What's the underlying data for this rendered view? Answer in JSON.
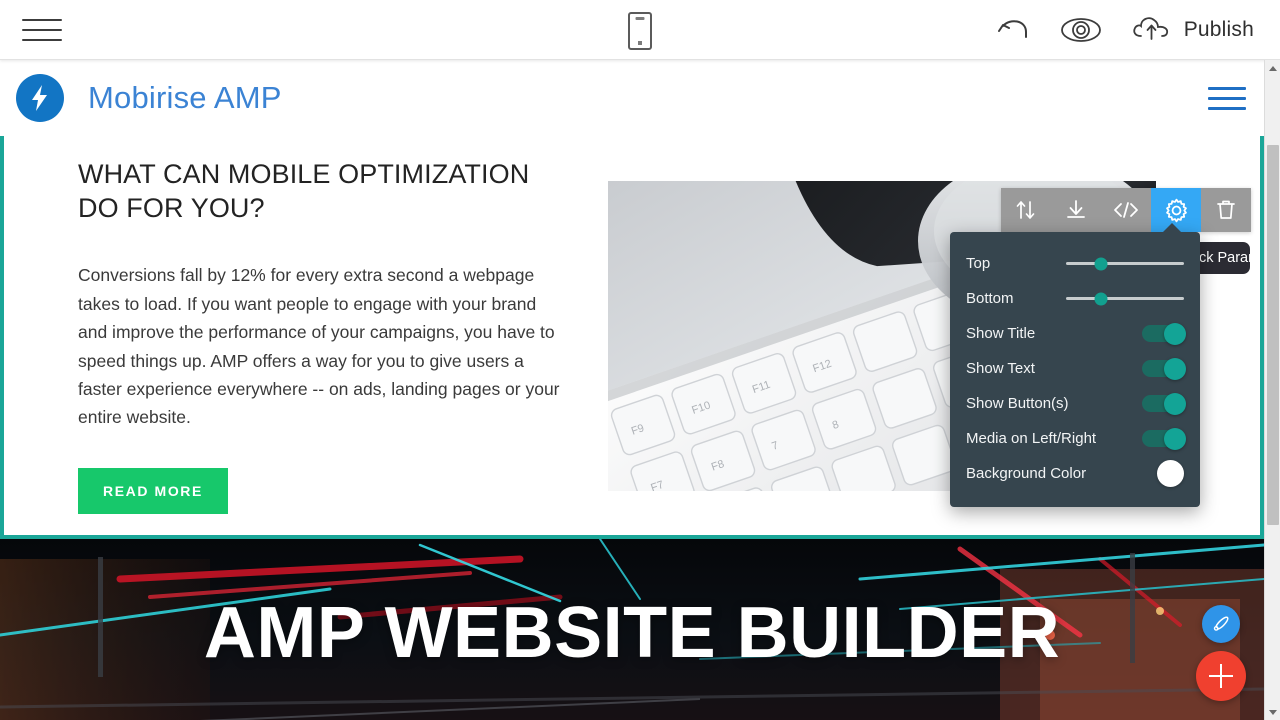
{
  "appbar": {
    "menu_icon": "hamburger-menu-icon",
    "device_icon": "mobile-device-preview-icon",
    "undo_icon": "undo-arrow-icon",
    "preview_icon": "eye-preview-icon",
    "publish_icon": "cloud-upload-icon",
    "publish_label": "Publish"
  },
  "site_nav": {
    "logo_icon": "lightning-bolt-logo-icon",
    "brand": "Mobirise AMP",
    "menu_icon": "site-hamburger-menu-icon",
    "brand_color": "#3b83d4",
    "logo_bg": "#1275c4"
  },
  "block": {
    "title": "WHAT CAN MOBILE OPTIMIZATION DO FOR YOU?",
    "body": "Conversions fall by 12% for every extra second a webpage takes to load. If you want people to engage with your brand and improve the performance of your campaigns, you have to speed things up. AMP offers a way for you to give users a faster experience everywhere -- on ads, landing pages or your entire website.",
    "button_label": "READ MORE",
    "button_color": "#17c86b",
    "selection_color": "#1aa698",
    "media_alt": "keyboard-and-phone-photo"
  },
  "hero": {
    "title": "AMP WEBSITE BUILDER"
  },
  "block_toolbar": {
    "items": [
      {
        "name": "move-block-icon",
        "label": "move"
      },
      {
        "name": "download-block-icon",
        "label": "download"
      },
      {
        "name": "edit-code-icon",
        "label": "</>"
      },
      {
        "name": "block-parameters-gear-icon",
        "label": "settings"
      },
      {
        "name": "delete-block-icon",
        "label": "delete"
      }
    ],
    "active_index": 3,
    "active_color": "#34a8f5",
    "bar_color": "#9a9a9a"
  },
  "tooltip": {
    "text": "Block Parameters"
  },
  "settings_panel": {
    "rows": [
      {
        "label": "Top",
        "type": "slider",
        "value": 30
      },
      {
        "label": "Bottom",
        "type": "slider",
        "value": 30
      },
      {
        "label": "Show Title",
        "type": "toggle",
        "value": "on"
      },
      {
        "label": "Show Text",
        "type": "toggle",
        "value": "on"
      },
      {
        "label": "Show Button(s)",
        "type": "toggle",
        "value": "on"
      },
      {
        "label": "Media on Left/Right",
        "type": "toggle",
        "value": "on"
      },
      {
        "label": "Background Color",
        "type": "color",
        "value": "#ffffff"
      }
    ],
    "panel_color": "#36454e",
    "accent_color": "#13a496"
  },
  "fabs": {
    "style_icon": "pen-style-editor-icon",
    "add_icon": "plus-add-block-icon",
    "style_color": "#2f94e8",
    "add_color": "#f0402f"
  },
  "scrollbar": {
    "up_icon": "scroll-up-arrow-icon",
    "down_icon": "scroll-down-arrow-icon",
    "thumb": "scrollbar-thumb"
  }
}
